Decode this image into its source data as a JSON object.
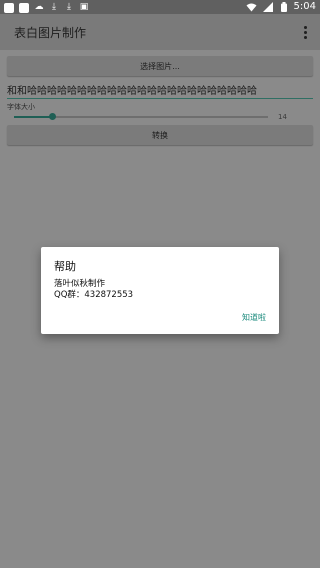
{
  "status_bar": {
    "time": "5:04",
    "left_icons": [
      "app-square-icon",
      "app-square-icon",
      "cloud-icon",
      "download-icon",
      "download-icon",
      "image-icon"
    ],
    "right_icons": [
      "wifi-icon",
      "signal-icon",
      "battery-icon"
    ]
  },
  "app_bar": {
    "title": "表白图片制作",
    "menu_icon": "overflow-menu-icon"
  },
  "main": {
    "choose_image_label": "选择图片...",
    "text_input_value": "和和哈哈哈哈哈哈哈哈哈哈哈哈哈哈哈哈哈哈哈哈哈哈哈",
    "font_size_label": "字体大小",
    "font_size_value": "14",
    "font_size_fraction": 0.15,
    "convert_label": "转换"
  },
  "dialog": {
    "title": "帮助",
    "line1": "落叶似秋制作",
    "line2": "QQ群：432872553",
    "ok_label": "知道啦"
  },
  "colors": {
    "accent": "#1f5f55",
    "dialog_button": "#1a8a7c",
    "scrim": "#8a8a8a"
  }
}
